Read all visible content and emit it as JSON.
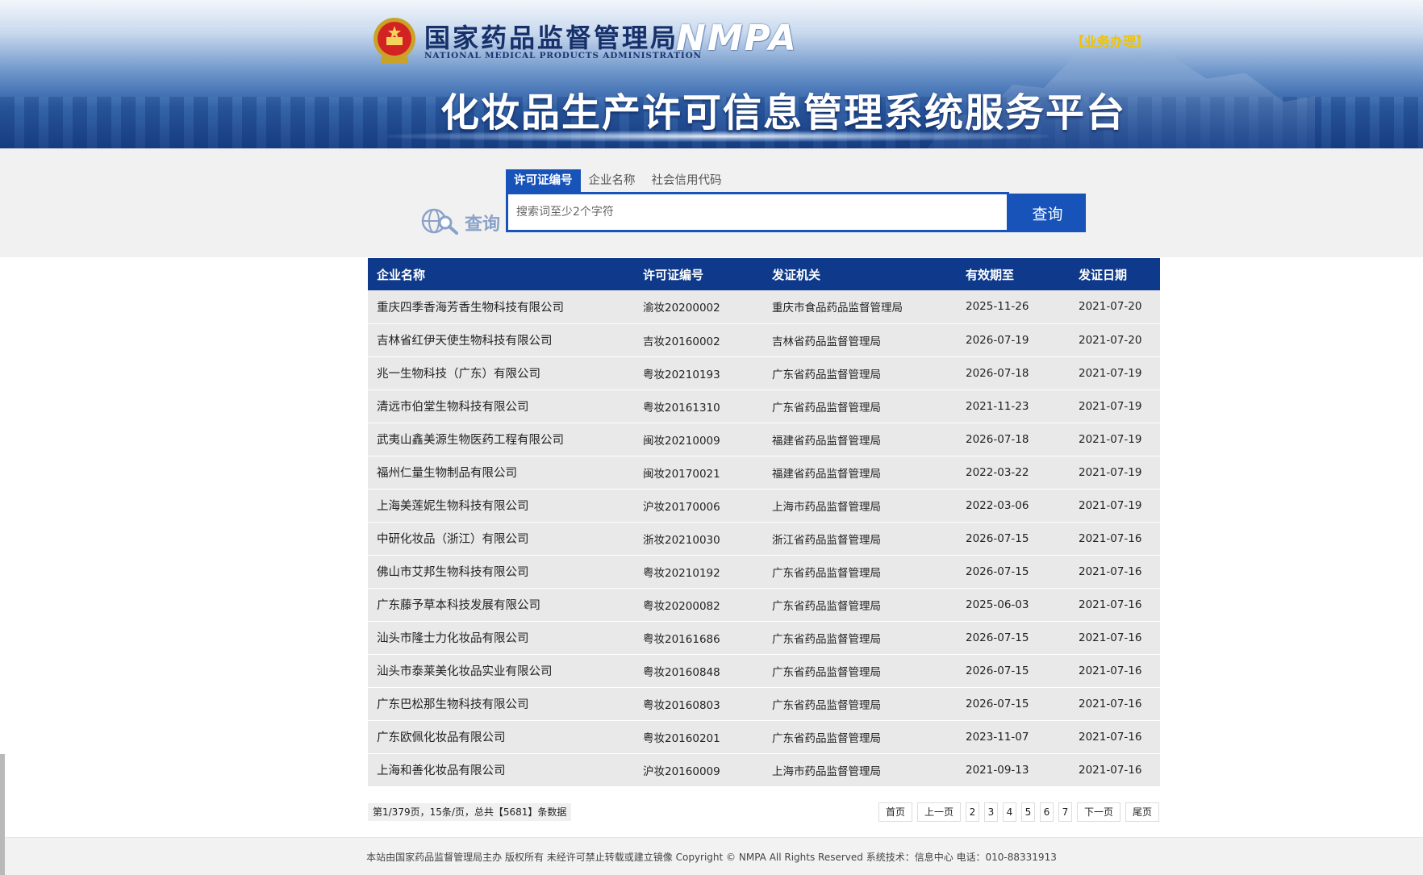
{
  "header": {
    "agency_cn": "国家药品监督管理局",
    "agency_en": "NATIONAL MEDICAL PRODUCTS ADMINISTRATION",
    "agency_abbr": "NMPA",
    "biz_link": "【业务办理】",
    "system_title": "化妆品生产许可信息管理系统服务平台"
  },
  "search": {
    "logo_text": "查询",
    "tabs": [
      "许可证编号",
      "企业名称",
      "社会信用代码"
    ],
    "active_tab": "许可证编号",
    "placeholder": "搜索词至少2个字符",
    "button_label": "查询"
  },
  "table": {
    "columns": [
      "企业名称",
      "许可证编号",
      "发证机关",
      "有效期至",
      "发证日期"
    ],
    "rows": [
      [
        "重庆四季香海芳香生物科技有限公司",
        "渝妆20200002",
        "重庆市食品药品监督管理局",
        "2025-11-26",
        "2021-07-20"
      ],
      [
        "吉林省红伊天使生物科技有限公司",
        "吉妆20160002",
        "吉林省药品监督管理局",
        "2026-07-19",
        "2021-07-20"
      ],
      [
        "兆一生物科技（广东）有限公司",
        "粤妆20210193",
        "广东省药品监督管理局",
        "2026-07-18",
        "2021-07-19"
      ],
      [
        "清远市伯堂生物科技有限公司",
        "粤妆20161310",
        "广东省药品监督管理局",
        "2021-11-23",
        "2021-07-19"
      ],
      [
        "武夷山鑫美源生物医药工程有限公司",
        "闽妆20210009",
        "福建省药品监督管理局",
        "2026-07-18",
        "2021-07-19"
      ],
      [
        "福州仁量生物制品有限公司",
        "闽妆20170021",
        "福建省药品监督管理局",
        "2022-03-22",
        "2021-07-19"
      ],
      [
        "上海美莲妮生物科技有限公司",
        "沪妆20170006",
        "上海市药品监督管理局",
        "2022-03-06",
        "2021-07-19"
      ],
      [
        "中研化妆品（浙江）有限公司",
        "浙妆20210030",
        "浙江省药品监督管理局",
        "2026-07-15",
        "2021-07-16"
      ],
      [
        "佛山市艾邦生物科技有限公司",
        "粤妆20210192",
        "广东省药品监督管理局",
        "2026-07-15",
        "2021-07-16"
      ],
      [
        "广东藤予草本科技发展有限公司",
        "粤妆20200082",
        "广东省药品监督管理局",
        "2025-06-03",
        "2021-07-16"
      ],
      [
        "汕头市隆士力化妆品有限公司",
        "粤妆20161686",
        "广东省药品监督管理局",
        "2026-07-15",
        "2021-07-16"
      ],
      [
        "汕头市泰莱美化妆品实业有限公司",
        "粤妆20160848",
        "广东省药品监督管理局",
        "2026-07-15",
        "2021-07-16"
      ],
      [
        "广东巴松那生物科技有限公司",
        "粤妆20160803",
        "广东省药品监督管理局",
        "2026-07-15",
        "2021-07-16"
      ],
      [
        "广东欧佩化妆品有限公司",
        "粤妆20160201",
        "广东省药品监督管理局",
        "2023-11-07",
        "2021-07-16"
      ],
      [
        "上海和善化妆品有限公司",
        "沪妆20160009",
        "上海市药品监督管理局",
        "2021-09-13",
        "2021-07-16"
      ]
    ]
  },
  "pagination": {
    "info": "第1/379页，15条/页，总共【5681】条数据",
    "first": "首页",
    "prev": "上一页",
    "pages": [
      "2",
      "3",
      "4",
      "5",
      "6",
      "7"
    ],
    "next": "下一页",
    "last": "尾页"
  },
  "footer": {
    "text": "本站由国家药品监督管理局主办 版权所有 未经许可禁止转载或建立镜像 Copyright © NMPA All Rights Reserved 系统技术：信息中心 电话：010-88331913"
  },
  "colors": {
    "primary": "#1753b8",
    "table_header": "#0f3a8b",
    "accent_gold": "#f0c200"
  },
  "icons": {
    "emblem": "national-emblem-icon",
    "search_logo": "globe-magnifier-icon"
  }
}
